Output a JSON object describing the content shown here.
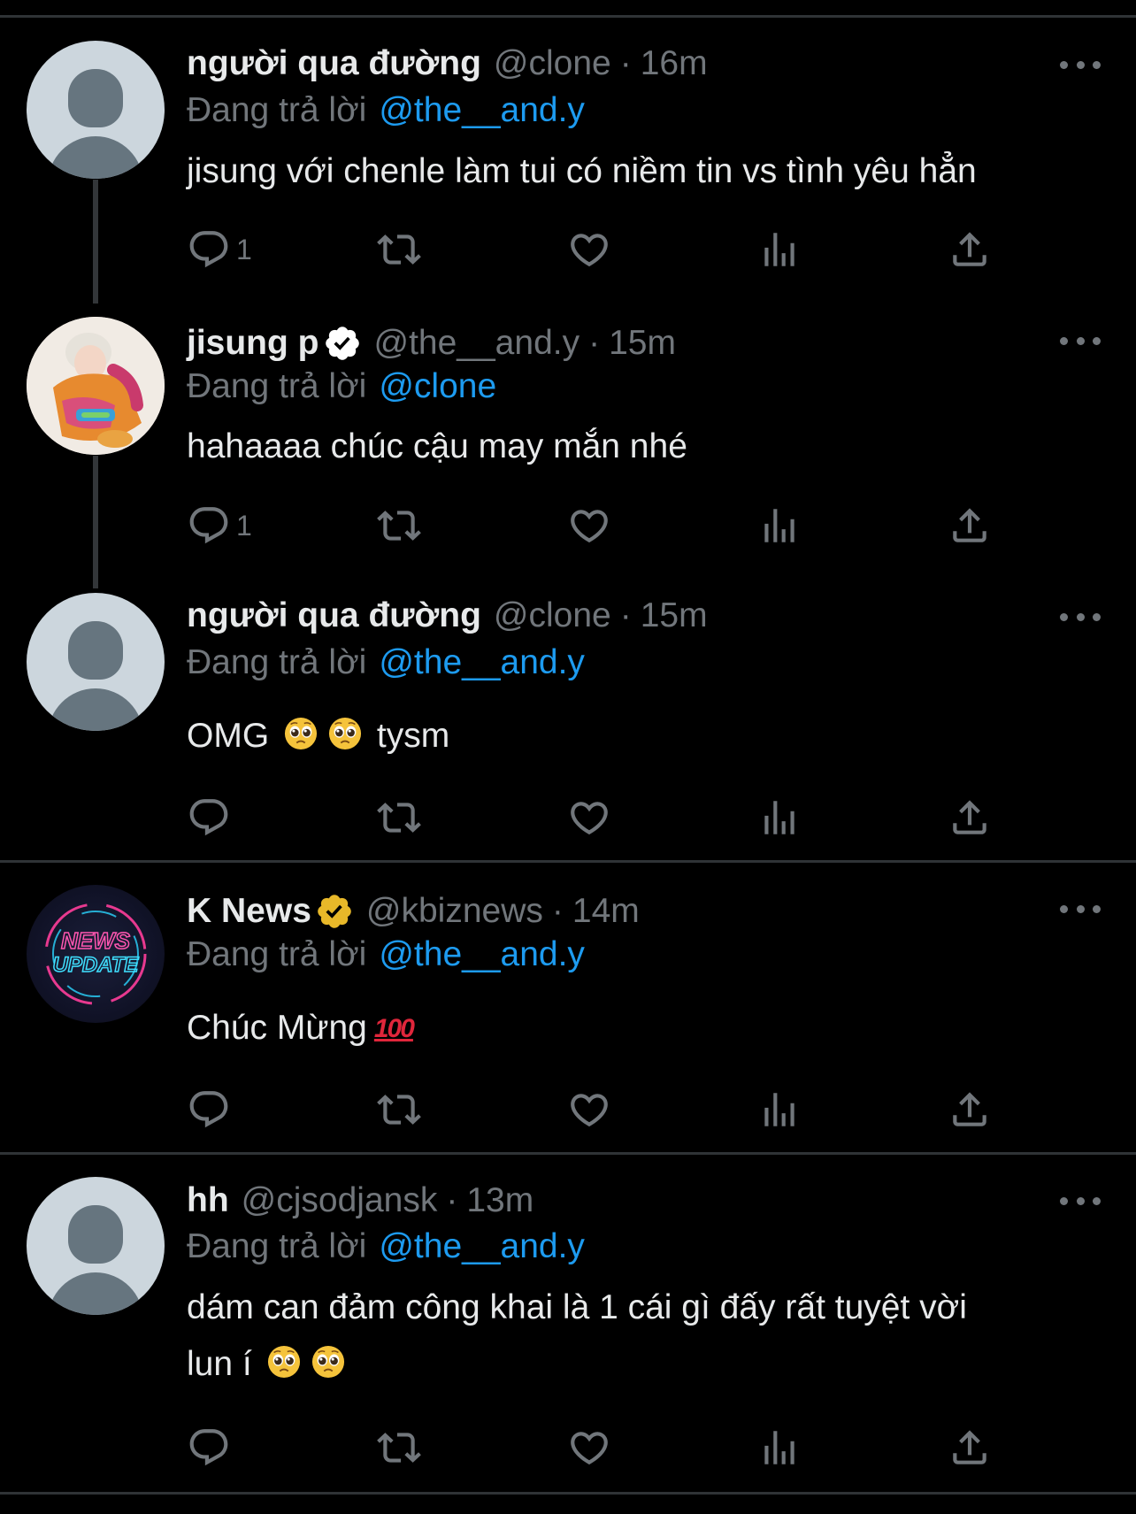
{
  "tweets": [
    {
      "name": "người qua đường",
      "verified": false,
      "handle": "@clone",
      "time": "16m",
      "reply_prefix": "Đang trả lời",
      "reply_to": "@the__and.y",
      "text": "jisung với chenle làm tui có niềm tin vs tình yêu hẳn",
      "reply_count": "1"
    },
    {
      "name": "jisung p",
      "verified": true,
      "handle": "@the__and.y",
      "time": "15m",
      "reply_prefix": "Đang trả lời",
      "reply_to": "@clone",
      "text": "hahaaaa chúc cậu may mắn nhé",
      "reply_count": "1"
    },
    {
      "name": "người qua đường",
      "verified": false,
      "handle": "@clone",
      "time": "15m",
      "reply_prefix": "Đang trả lời",
      "reply_to": "@the__and.y",
      "text_a": "OMG",
      "text_b": "tysm",
      "reply_count": ""
    },
    {
      "name": "K News",
      "verified": true,
      "handle": "@kbiznews",
      "time": "14m",
      "reply_prefix": "Đang trả lời",
      "reply_to": "@the__and.y",
      "text": "Chúc Mừng",
      "emoji_100": "100",
      "avatar_text_1": "NEWS",
      "avatar_text_2": "UPDATE",
      "reply_count": ""
    },
    {
      "name": "hh",
      "verified": false,
      "handle": "@cjsodjansk",
      "time": "13m",
      "reply_prefix": "Đang trả lời",
      "reply_to": "@the__and.y",
      "text_line1": "dám can đảm công khai là 1 cái gì đấy rất tuyệt vời",
      "text_line2": "lun í",
      "reply_count": ""
    }
  ],
  "separator": "·",
  "icons": [
    "reply-icon",
    "retweet-icon",
    "like-icon",
    "views-icon",
    "share-icon",
    "more-icon",
    "verified-badge-icon"
  ],
  "colors": {
    "background": "#000000",
    "mention": "#1d9bf0",
    "secondary": "#71767b",
    "verified_gold": "#e8b829"
  }
}
